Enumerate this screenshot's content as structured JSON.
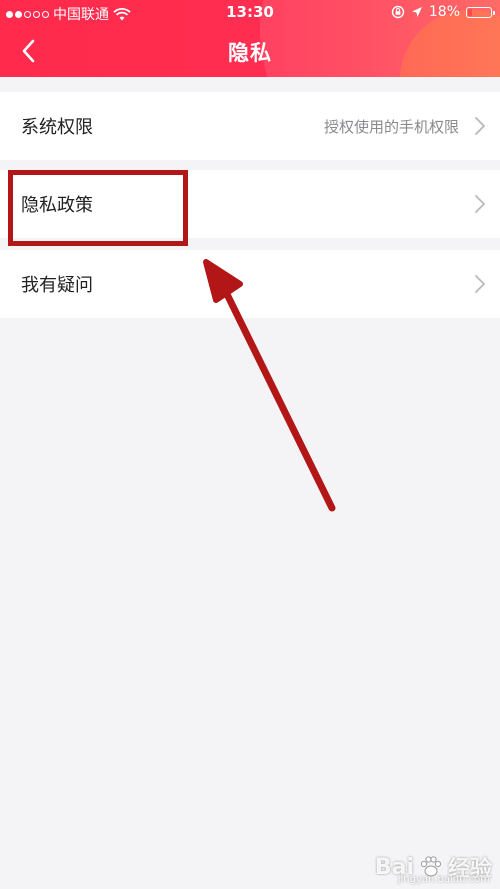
{
  "status_bar": {
    "carrier": "中国联通",
    "time": "13:30",
    "battery": "18%",
    "battery_level": 0.18
  },
  "navbar": {
    "title": "隐私"
  },
  "settings": {
    "items": [
      {
        "label": "系统权限",
        "value": "授权使用的手机权限"
      },
      {
        "label": "隐私政策",
        "value": ""
      },
      {
        "label": "我有疑问",
        "value": ""
      }
    ]
  },
  "watermark": {
    "text": "Bai",
    "text2": "经验",
    "sub": "jingyan.baidu.com"
  },
  "colors": {
    "header": "#ff2e50",
    "annotation": "#b21616",
    "background": "#f4f4f6"
  }
}
